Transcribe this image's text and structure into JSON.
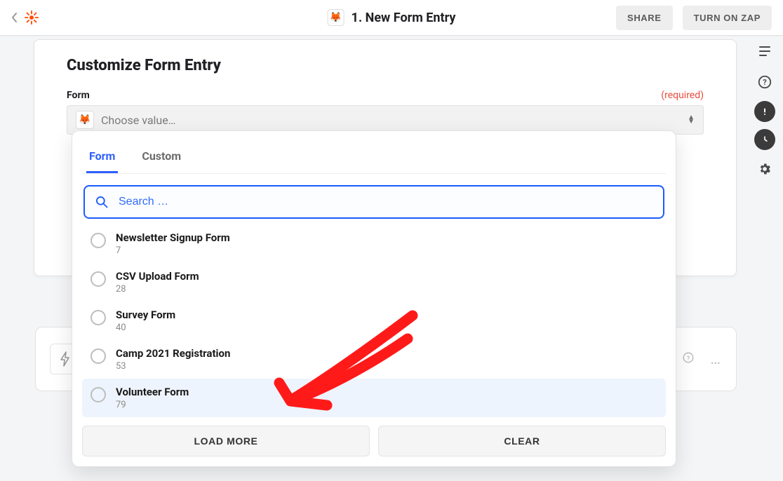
{
  "header": {
    "title": "1. New Form Entry",
    "share_label": "SHARE",
    "turn_on_label": "TURN ON ZAP"
  },
  "card": {
    "heading": "Customize Form Entry",
    "field_label": "Form",
    "required_label": "(required)",
    "placeholder": "Choose value…"
  },
  "dropdown": {
    "tabs": {
      "form": "Form",
      "custom": "Custom"
    },
    "search_placeholder": "Search …",
    "options": [
      {
        "name": "Newsletter Signup Form",
        "id": "7"
      },
      {
        "name": "CSV Upload Form",
        "id": "28"
      },
      {
        "name": "Survey Form",
        "id": "40"
      },
      {
        "name": "Camp 2021 Registration",
        "id": "53"
      },
      {
        "name": "Volunteer Form",
        "id": "79"
      }
    ],
    "load_more_label": "LOAD MORE",
    "clear_label": "CLEAR"
  },
  "rail": {
    "notes_icon": "notes-icon",
    "help_icon": "help-icon",
    "alert_icon": "alert-icon",
    "history_icon": "history-icon",
    "settings_icon": "settings-icon"
  }
}
